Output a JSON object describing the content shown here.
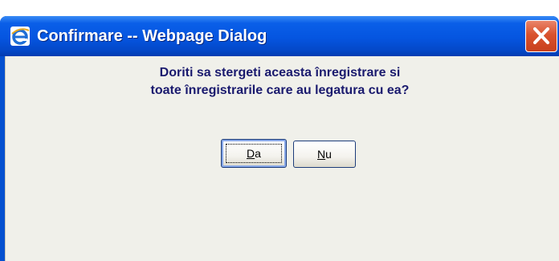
{
  "dialog": {
    "title": "Confirmare -- Webpage Dialog",
    "title_icon": "internet-explorer-icon",
    "close_icon": "close-icon",
    "colors": {
      "titlebar": "#0555e0",
      "client": "#f0f0ea",
      "message_text": "#1a1a6e",
      "close_button": "#d9522d"
    }
  },
  "message": {
    "line1": "Doriti sa stergeti aceasta înregistrare si",
    "line2": "toate înregistrarile care au legatura cu ea?"
  },
  "buttons": {
    "yes": {
      "mnemonic": "D",
      "rest": "a"
    },
    "no": {
      "mnemonic": "N",
      "rest": "u"
    }
  }
}
